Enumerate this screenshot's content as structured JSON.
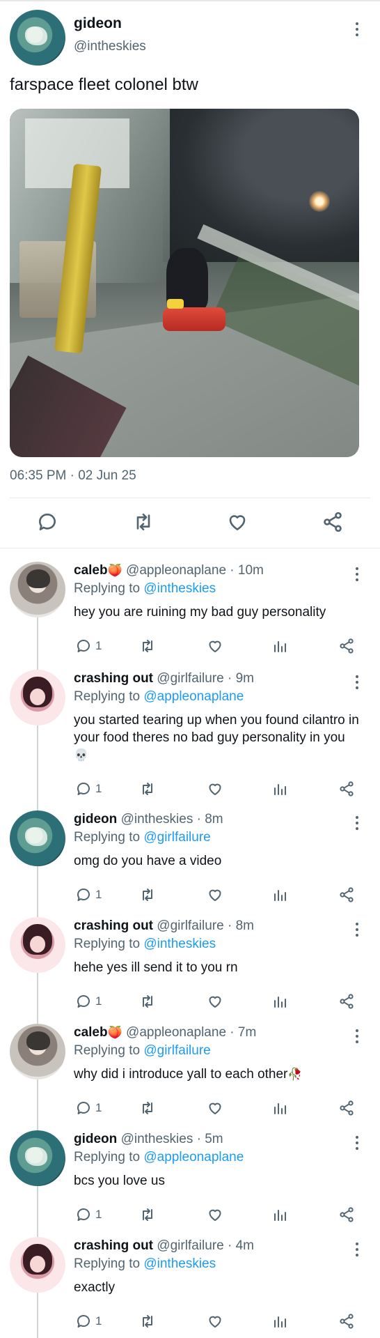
{
  "main_tweet": {
    "name": "gideon",
    "handle": "@intheskies",
    "text": "farspace fleet colonel btw",
    "timestamp": "06:35 PM · 02 Jun 25"
  },
  "replies": [
    {
      "name": "caleb",
      "name_emoji": "🍑",
      "handle": "@appleonaplane",
      "time": "10m",
      "replying_prefix": "Replying to",
      "replying_to": "@intheskies",
      "text": "hey you are ruining my bad guy personality",
      "text_emoji": "",
      "reply_count": "1"
    },
    {
      "name": "crashing out",
      "name_emoji": "",
      "handle": "@girlfailure",
      "time": "9m",
      "replying_prefix": "Replying to",
      "replying_to": "@appleonaplane",
      "text": "you started tearing up when you found cilantro in your food theres no bad guy personality in you",
      "text_emoji": "💀",
      "reply_count": "1"
    },
    {
      "name": "gideon",
      "name_emoji": "",
      "handle": "@intheskies",
      "time": "8m",
      "replying_prefix": "Replying to",
      "replying_to": "@girlfailure",
      "text": "omg do you have a video",
      "text_emoji": "",
      "reply_count": "1"
    },
    {
      "name": "crashing out",
      "name_emoji": "",
      "handle": "@girlfailure",
      "time": "8m",
      "replying_prefix": "Replying to",
      "replying_to": "@intheskies",
      "text": "hehe yes ill send it to you rn",
      "text_emoji": "",
      "reply_count": "1"
    },
    {
      "name": "caleb",
      "name_emoji": "🍑",
      "handle": "@appleonaplane",
      "time": "7m",
      "replying_prefix": "Replying to",
      "replying_to": "@girlfailure",
      "text": "why did i introduce yall to each other",
      "text_emoji": "🥀",
      "reply_count": "1"
    },
    {
      "name": "gideon",
      "name_emoji": "",
      "handle": "@intheskies",
      "time": "5m",
      "replying_prefix": "Replying to",
      "replying_to": "@appleonaplane",
      "text": "bcs you love us",
      "text_emoji": "",
      "reply_count": "1"
    },
    {
      "name": "crashing out",
      "name_emoji": "",
      "handle": "@girlfailure",
      "time": "4m",
      "replying_prefix": "Replying to",
      "replying_to": "@intheskies",
      "text": "exactly",
      "text_emoji": "",
      "reply_count": "1"
    }
  ],
  "colors": {
    "text": "#0f1419",
    "secondary": "#536471",
    "mention": "#1d9bf0",
    "divider": "#e6e9ea"
  }
}
